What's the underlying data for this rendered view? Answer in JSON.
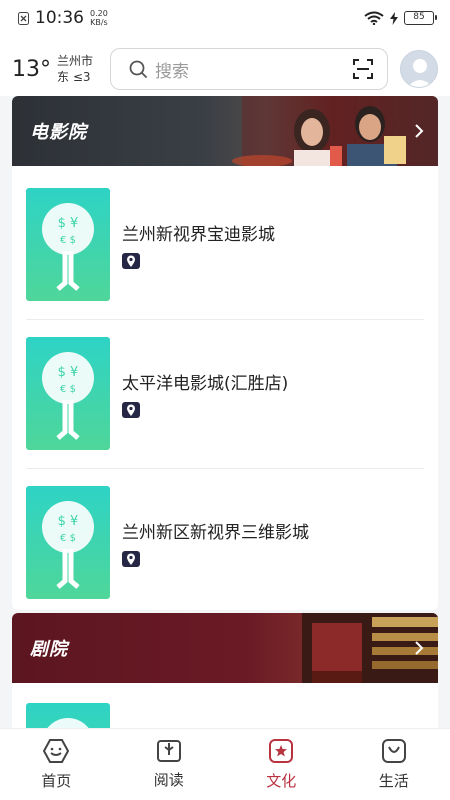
{
  "status_bar": {
    "time": "10:36",
    "net_speed_value": "0.20",
    "net_speed_unit": "KB/s",
    "battery": "85"
  },
  "header": {
    "temperature": "13°",
    "city": "兰州市",
    "wind": "东 ≤3",
    "search_placeholder": "搜索"
  },
  "sections": [
    {
      "title": "电影院",
      "venues": [
        {
          "name": "兰州新视界宝迪影城"
        },
        {
          "name": "太平洋电影城(汇胜店)"
        },
        {
          "name": "兰州新区新视界三维影城"
        }
      ]
    },
    {
      "title": "剧院",
      "venues": [
        {
          "name": ""
        }
      ]
    }
  ],
  "bottom_nav": [
    {
      "label": "首页",
      "icon": "home-icon"
    },
    {
      "label": "阅读",
      "icon": "book-icon"
    },
    {
      "label": "文化",
      "icon": "culture-star-icon",
      "active": true
    },
    {
      "label": "生活",
      "icon": "life-bag-icon"
    }
  ],
  "colors": {
    "accent": "#b83340",
    "thumb_gradient_top": "#2ed3c5",
    "thumb_gradient_bottom": "#4fd69a"
  }
}
